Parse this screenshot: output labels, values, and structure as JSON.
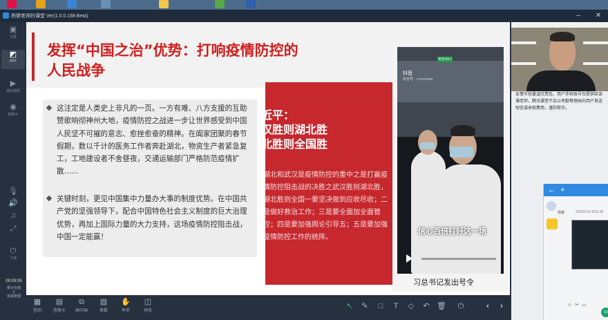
{
  "window": {
    "title": "杨健老师的课堂 Ver(1.0.0.168 Beta)"
  },
  "leftbar": {
    "items": [
      {
        "label": "分屏",
        "sub": "课"
      },
      {
        "label": "PPT"
      },
      {
        "label": "播放视频"
      },
      {
        "label": "摄像头"
      }
    ],
    "exit_label": "下课",
    "timer": "00:03:05",
    "misc_line1": "累计在线",
    "misc_line2": "0",
    "misc_line3": "资源管理"
  },
  "slide": {
    "title": "发挥“中国之治”优势：打响疫情防控的人民战争",
    "paragraph1": "这注定是人类史上非凡的一页。一方有难、八方支援的互助赞歌响彻神州大地，疫情防控之战进一步让世界感受到中国人民坚不可摧的意志、愈挫愈奋的精神。在阖家团聚的春节假期，数以千计的医务工作者奔赴湖北，物资生产者紧急复工，工地建设者不舍昼夜，交通运输部门严格防范疫情扩散……",
    "paragraph2": "关键时刻，更见中国集中力量办大事的制度优势。在中国共产党的坚强领导下，配合中国特色社会主义制度的巨大治理优势，再加上国际力量的大力支持，这场疫情防控阻击战，中国一定能赢！",
    "red_heading_1": "近平：",
    "red_heading_2": "汉胜则湖北胜",
    "red_heading_3": "北胜则全国胜",
    "red_body": "湖北和武汉是疫情防控的重中之是打赢疫情防控阻击战的决胜之武汉胜则湖北胜，湖北胜则全国一要坚决做到应收尽收；二是做好救治工作；三是要全面加全面管控；四是要加强舆论引导五；五是要加强疫情防控工作的统挥。",
    "video": {
      "brand": "抖音",
      "account": "抖音号：cctvnews",
      "exit_sign": "安全出口",
      "subtitle": "信心百倍打好这一场",
      "caption": "习总书记发出号令"
    }
  },
  "bottombar": {
    "items": [
      {
        "label": "签到"
      },
      {
        "label": "答题卡"
      },
      {
        "label": "画中画"
      },
      {
        "label": "奥数"
      },
      {
        "label": "举手"
      },
      {
        "label": "预览"
      }
    ]
  },
  "rightpanel": {
    "notice": "友情节轻量温究责任。用户手机账号仅提供给该课老师，腾讯课堂不会以考勤等理由向用户发送短信或收取费用，谨防欺诈。"
  },
  "chat": {
    "name": "杨健",
    "time": "2020/1/14 9:01:35"
  },
  "badge": "53"
}
